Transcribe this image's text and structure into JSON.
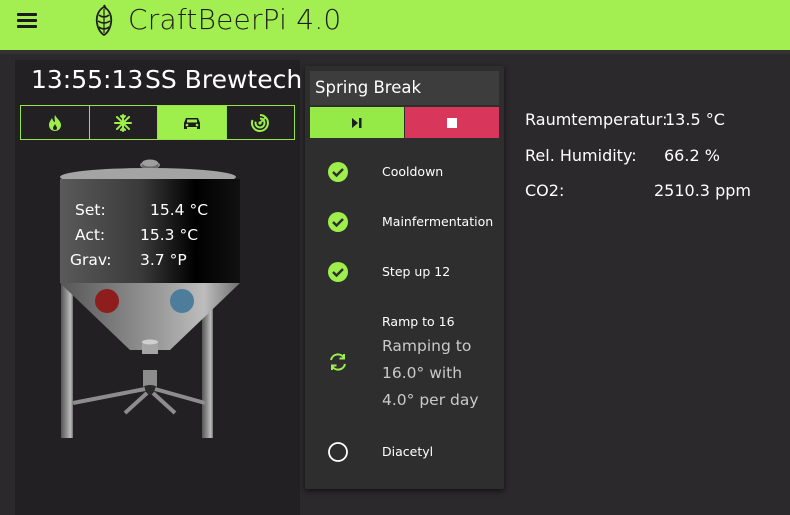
{
  "app": {
    "title": "CraftBeerPi 4.0"
  },
  "kettle": {
    "time": "13:55:13",
    "name": "SS Brewtech",
    "modes": [
      {
        "icon": "flame-icon",
        "active": false
      },
      {
        "icon": "snowflake-icon",
        "active": false
      },
      {
        "icon": "car-icon",
        "active": true
      },
      {
        "icon": "target-icon",
        "active": false
      }
    ],
    "readouts": [
      {
        "label": "Set:",
        "value": "15.4 °C"
      },
      {
        "label": "Act:",
        "value": "15.3 °C"
      },
      {
        "label": "Grav:",
        "value": "3.7 °P"
      }
    ]
  },
  "steps": {
    "title": "Spring Break",
    "items": [
      {
        "name": "Cooldown",
        "status": "done"
      },
      {
        "name": "Mainfermentation",
        "status": "done"
      },
      {
        "name": "Step up 12",
        "status": "done"
      },
      {
        "name": "Ramp to 16",
        "status": "active",
        "detail": "Ramping to 16.0° with 4.0° per day"
      },
      {
        "name": "Diacetyl",
        "status": "pending"
      }
    ]
  },
  "sensors": [
    {
      "label": "Raumtemperatur:",
      "value": "13.5 °C"
    },
    {
      "label": "Rel. Humidity:",
      "value": "66.2 %"
    },
    {
      "label": "CO2:",
      "value": "2510.3 ppm"
    }
  ],
  "colors": {
    "accent": "#a3ee50",
    "stop": "#d8365a",
    "background": "#2b292b",
    "panel": "#222022"
  }
}
